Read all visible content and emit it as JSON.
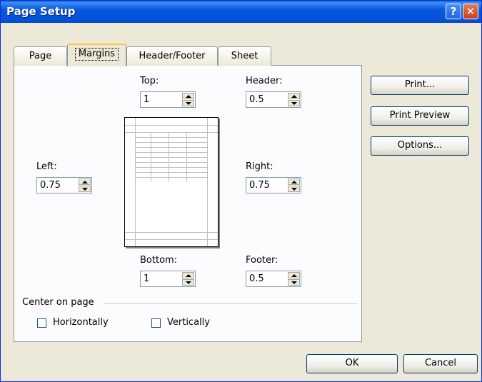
{
  "window": {
    "title": "Page Setup"
  },
  "tabs": [
    "Page",
    "Margins",
    "Header/Footer",
    "Sheet"
  ],
  "margins": {
    "top_label": "Top:",
    "top_value": "1",
    "header_label": "Header:",
    "header_value": "0.5",
    "left_label": "Left:",
    "left_value": "0.75",
    "right_label": "Right:",
    "right_value": "0.75",
    "bottom_label": "Bottom:",
    "bottom_value": "1",
    "footer_label": "Footer:",
    "footer_value": "0.5"
  },
  "center": {
    "group_label": "Center on page",
    "horizontally": "Horizontally",
    "vertically": "Vertically"
  },
  "side_buttons": {
    "print": "Print...",
    "preview": "Print Preview",
    "options": "Options..."
  },
  "footer_buttons": {
    "ok": "OK",
    "cancel": "Cancel"
  }
}
